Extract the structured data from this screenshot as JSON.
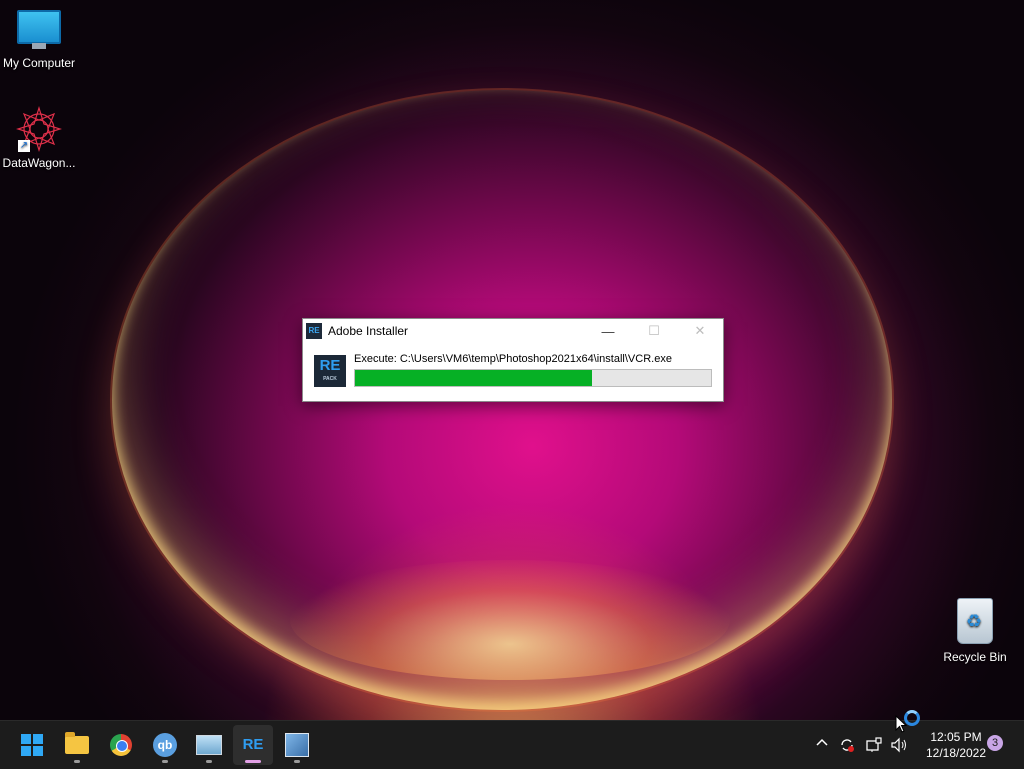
{
  "desktop": {
    "icons": [
      {
        "label": "My Computer",
        "icon": "monitor-icon"
      },
      {
        "label": "DataWagon...",
        "icon": "datawagon-icon"
      },
      {
        "label": "Recycle Bin",
        "icon": "recycle-bin-icon"
      }
    ]
  },
  "window": {
    "title": "Adobe Installer",
    "logo_small": "RE",
    "logo_big": "RE",
    "logo_sub": "PACK",
    "execute_text": "Execute: C:\\Users\\VM6\\temp\\Photoshop2021x64\\install\\VCR.exe",
    "progress_fraction": 0.665,
    "controls": {
      "minimize": "—",
      "maximize": "☐",
      "close": "✕"
    },
    "progress_color": "#06b025"
  },
  "taskbar": {
    "apps": [
      {
        "name": "start",
        "icon": "windows-start-icon"
      },
      {
        "name": "file-explorer",
        "icon": "folder-icon"
      },
      {
        "name": "chrome",
        "icon": "chrome-icon"
      },
      {
        "name": "qbittorrent",
        "icon": "qbittorrent-icon",
        "glyph": "qb"
      },
      {
        "name": "photos",
        "icon": "photos-icon"
      },
      {
        "name": "repack-installer",
        "icon": "repack-icon",
        "glyph": "RE"
      },
      {
        "name": "setup",
        "icon": "setup-icon"
      }
    ],
    "tray": {
      "chevron": "^",
      "time": "12:05 PM",
      "date": "12/18/2022",
      "notifications": "3"
    }
  }
}
